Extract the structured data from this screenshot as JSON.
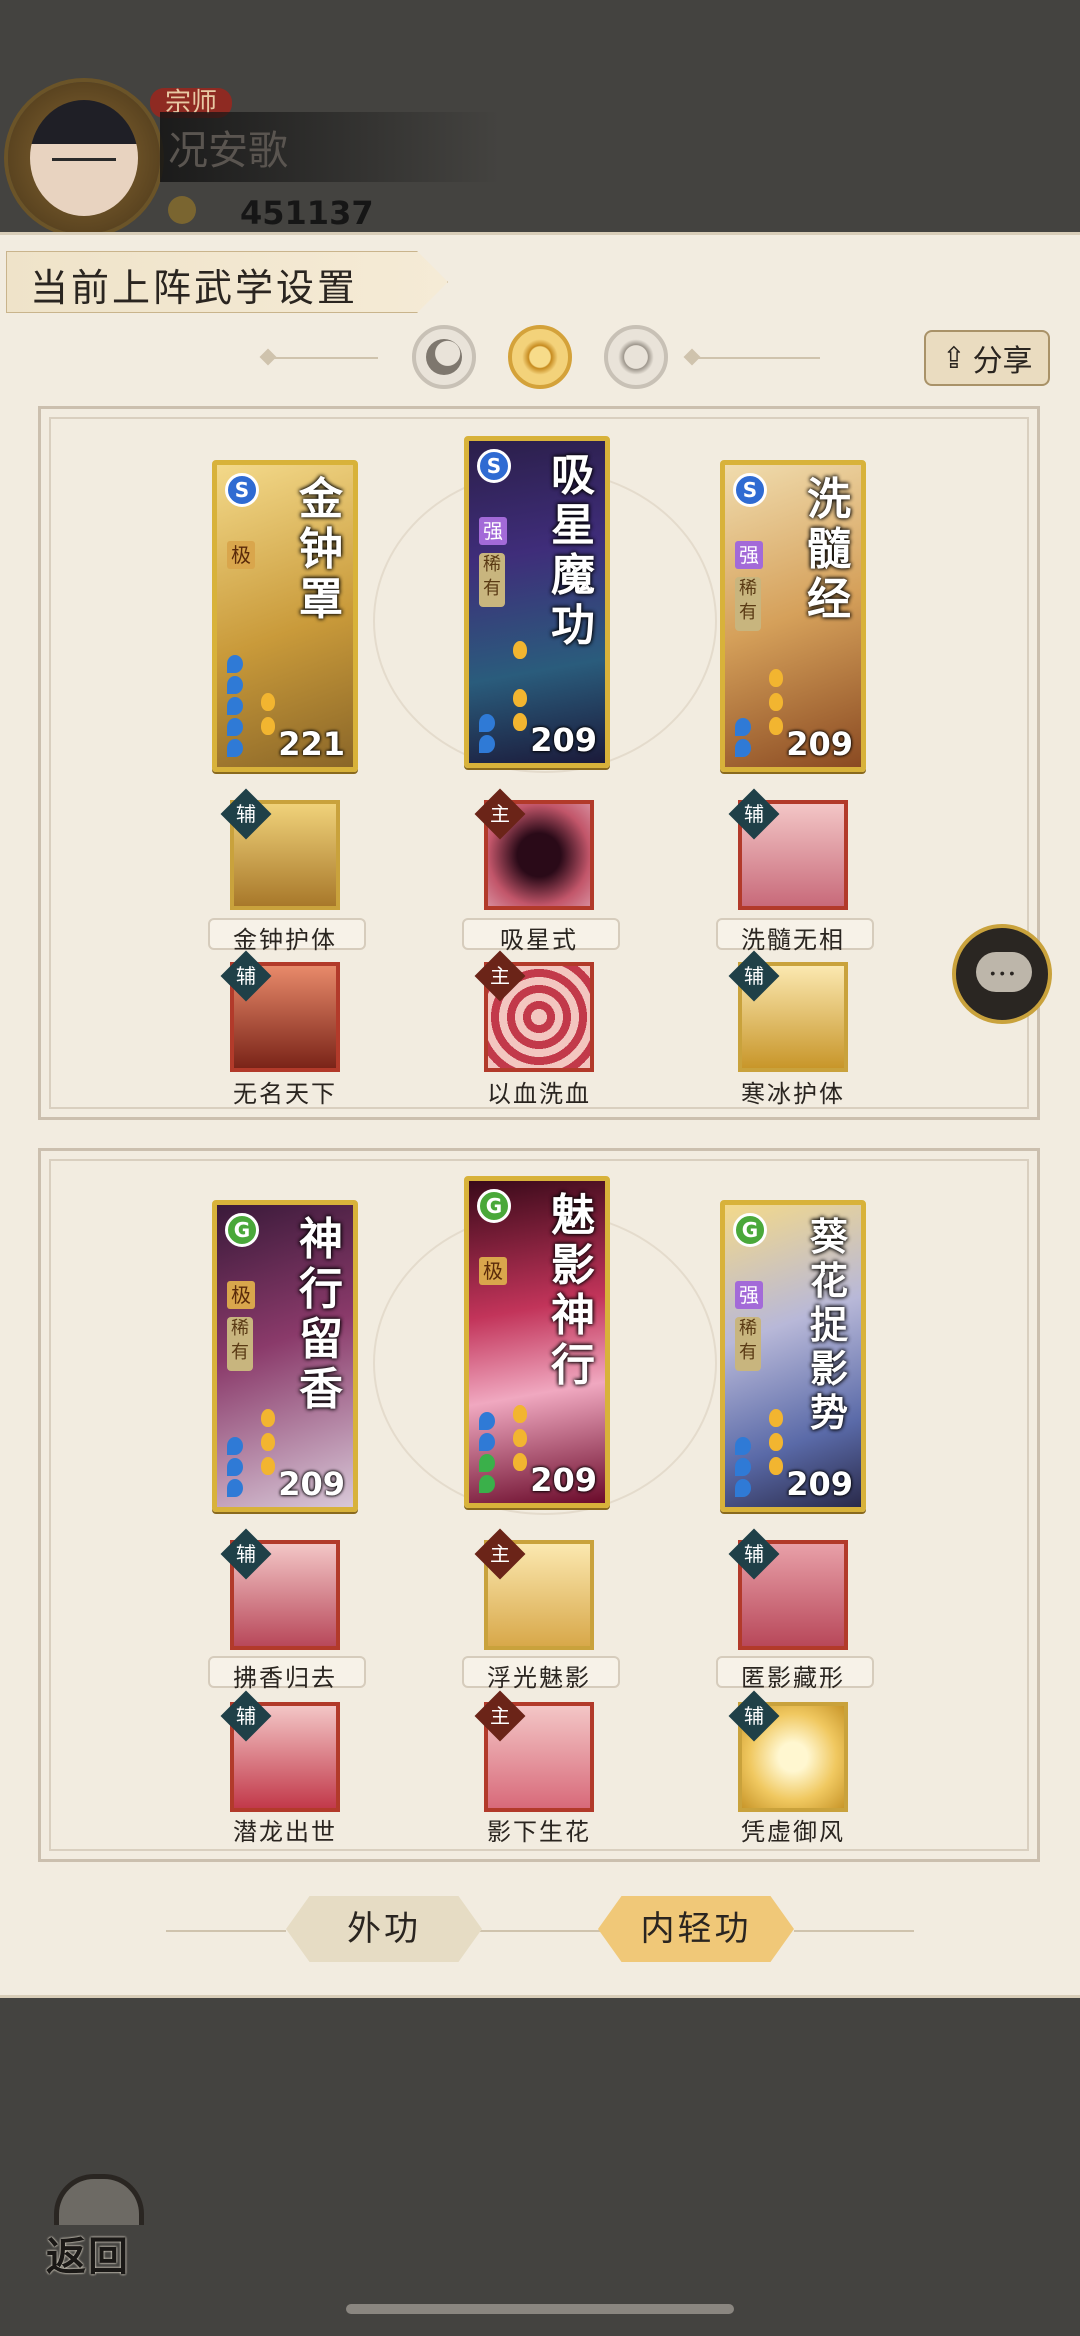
{
  "header": {
    "rank_badge": "宗师",
    "player_name": "况安歌",
    "power_value": "451137"
  },
  "panel": {
    "title": "当前上阵武学设置",
    "share_label": "分享"
  },
  "frame_top": {
    "cards": [
      {
        "title": "金钟罩",
        "grade": "极",
        "level": "221",
        "type": "S"
      },
      {
        "title": "吸星魔功",
        "grade": "强",
        "level": "209",
        "type": "S",
        "rare": "稀有"
      },
      {
        "title": "洗髓经",
        "grade": "强",
        "level": "209",
        "type": "S",
        "rare": "稀有"
      }
    ],
    "skills_row1": [
      {
        "tag": "辅",
        "name": "金钟护体"
      },
      {
        "tag": "主",
        "name": "吸星式"
      },
      {
        "tag": "辅",
        "name": "洗髓无相"
      }
    ],
    "skills_row2": [
      {
        "tag": "辅",
        "name": "无名天下"
      },
      {
        "tag": "主",
        "name": "以血洗血"
      },
      {
        "tag": "辅",
        "name": "寒冰护体"
      }
    ]
  },
  "frame_bottom": {
    "cards": [
      {
        "title": "神行留香",
        "grade": "极",
        "level": "209",
        "type": "G",
        "rare": "稀有"
      },
      {
        "title": "魅影神行",
        "grade": "极",
        "level": "209",
        "type": "G"
      },
      {
        "title": "葵花捉影势",
        "grade": "强",
        "level": "209",
        "type": "G",
        "rare": "稀有"
      }
    ],
    "skills_row1": [
      {
        "tag": "辅",
        "name": "拂香归去"
      },
      {
        "tag": "主",
        "name": "浮光魅影"
      },
      {
        "tag": "辅",
        "name": "匿影藏形"
      }
    ],
    "skills_row2": [
      {
        "tag": "辅",
        "name": "潜龙出世"
      },
      {
        "tag": "主",
        "name": "影下生花"
      },
      {
        "tag": "辅",
        "name": "凭虚御风"
      }
    ]
  },
  "tabs": {
    "outer": "外功",
    "inner": "内轻功"
  },
  "back_label": "返回",
  "colors": {
    "gold": "#d8b23a",
    "panel_bg": "#f2ece0",
    "tab_active": "#f0c878",
    "tab_inactive": "#e6dcc4"
  }
}
